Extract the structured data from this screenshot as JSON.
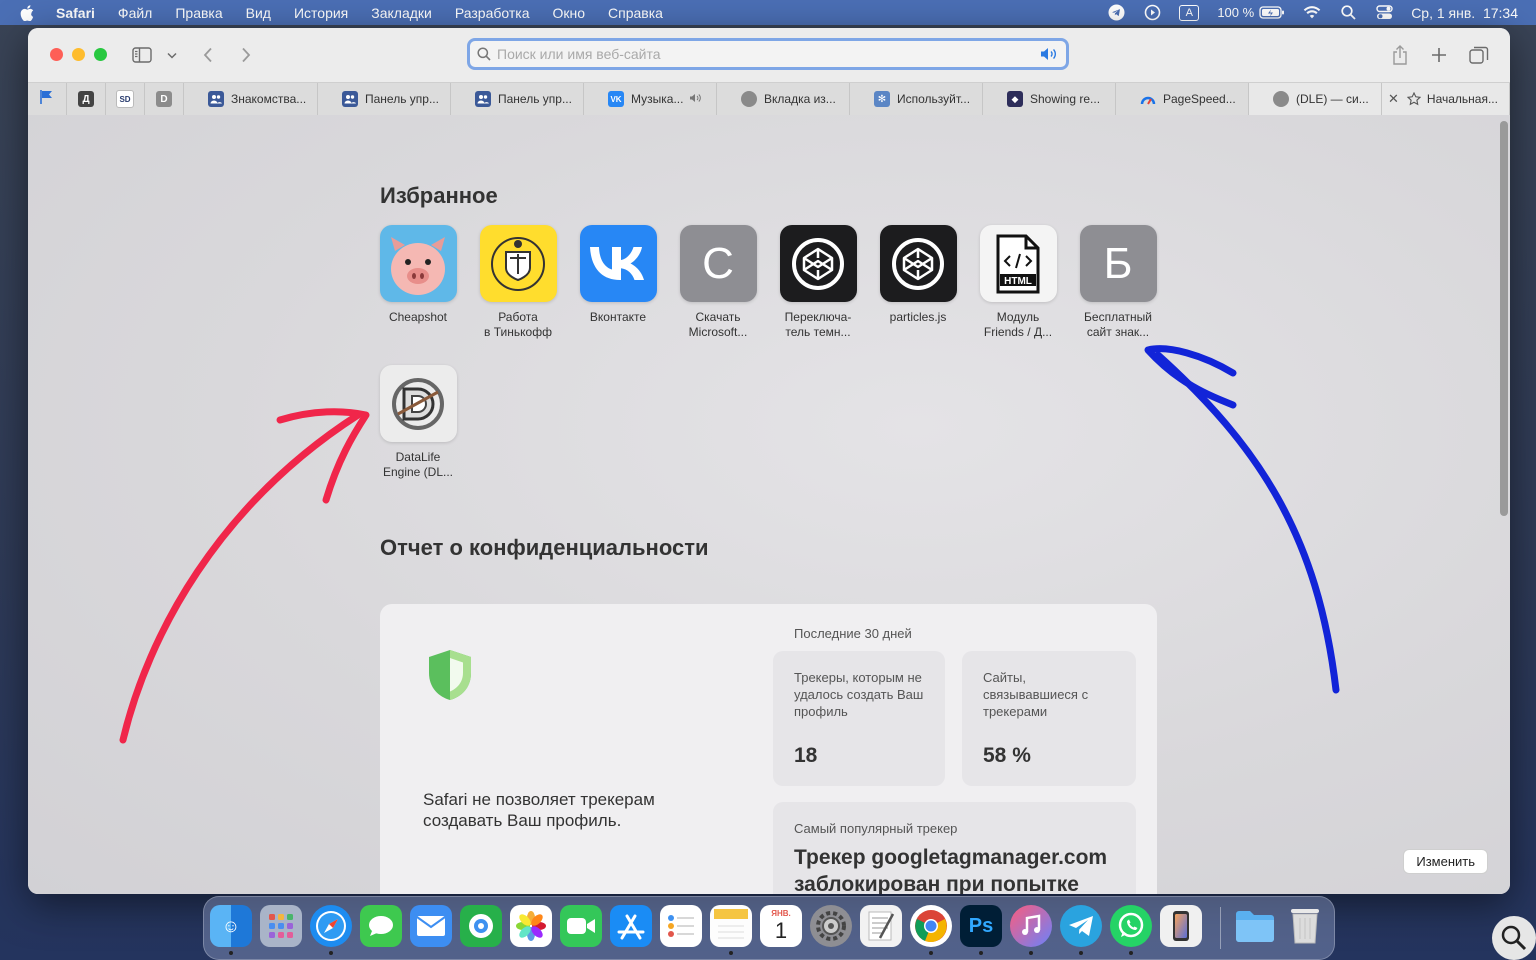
{
  "menubar": {
    "app": "Safari",
    "items": [
      "Файл",
      "Правка",
      "Вид",
      "История",
      "Закладки",
      "Разработка",
      "Окно",
      "Справка"
    ],
    "keyboard": "A",
    "battery": "100 %",
    "clock": "Ср, 1 янв.  17:34"
  },
  "toolbar": {
    "search_placeholder": "Поиск или имя веб-сайта"
  },
  "tabs": {
    "pinned": [
      "Д",
      "SD",
      "D"
    ],
    "items": [
      {
        "label": "Знакомства..."
      },
      {
        "label": "Панель упр..."
      },
      {
        "label": "Панель упр..."
      },
      {
        "label": "Музыка..."
      },
      {
        "label": "Вкладка из..."
      },
      {
        "label": "Используйт..."
      },
      {
        "label": "Showing re..."
      },
      {
        "label": "PageSpeed..."
      },
      {
        "label": "(DLE) — си..."
      },
      {
        "label": "Начальная..."
      }
    ]
  },
  "favorites": {
    "title": "Избранное",
    "items": [
      {
        "label": "Cheapshot"
      },
      {
        "label": "Работа\nв Тинькофф"
      },
      {
        "label": "Вконтакте"
      },
      {
        "label": "Скачать\nMicrosoft...",
        "letter": "С"
      },
      {
        "label": "Переключа-\nтель темн..."
      },
      {
        "label": "particles.js"
      },
      {
        "label": "Модуль\nFriends / Д..."
      },
      {
        "label": "Бесплатный\nсайт знак...",
        "letter": "Б"
      },
      {
        "label": "DataLife\nEngine (DL..."
      }
    ]
  },
  "privacy": {
    "title": "Отчет о конфиденциальности",
    "message": "Safari не позволяет трекерам создавать Ваш профиль.",
    "period": "Последние 30 дней",
    "trackers_label": "Трекеры, которым не удалось создать Ваш профиль",
    "trackers_value": "18",
    "sites_label": "Сайты, связывавшиеся с трекерами",
    "sites_value": "58 %",
    "top_tracker_label": "Самый популярный трекер",
    "top_tracker_text": "Трекер googletagmanager.com заблокирован при попытке"
  },
  "edit_button": "Изменить",
  "dock": {
    "calendar_month": "ЯНВ.",
    "calendar_day": "1",
    "ps": "Ps"
  },
  "colors": {
    "menubar": "#4b6fb5",
    "address_focus": "#7ea6e6",
    "vk": "#2787f5",
    "tinkoff": "#ffdd2d",
    "annotation_red": "#f0264a",
    "annotation_blue": "#1224d8"
  }
}
